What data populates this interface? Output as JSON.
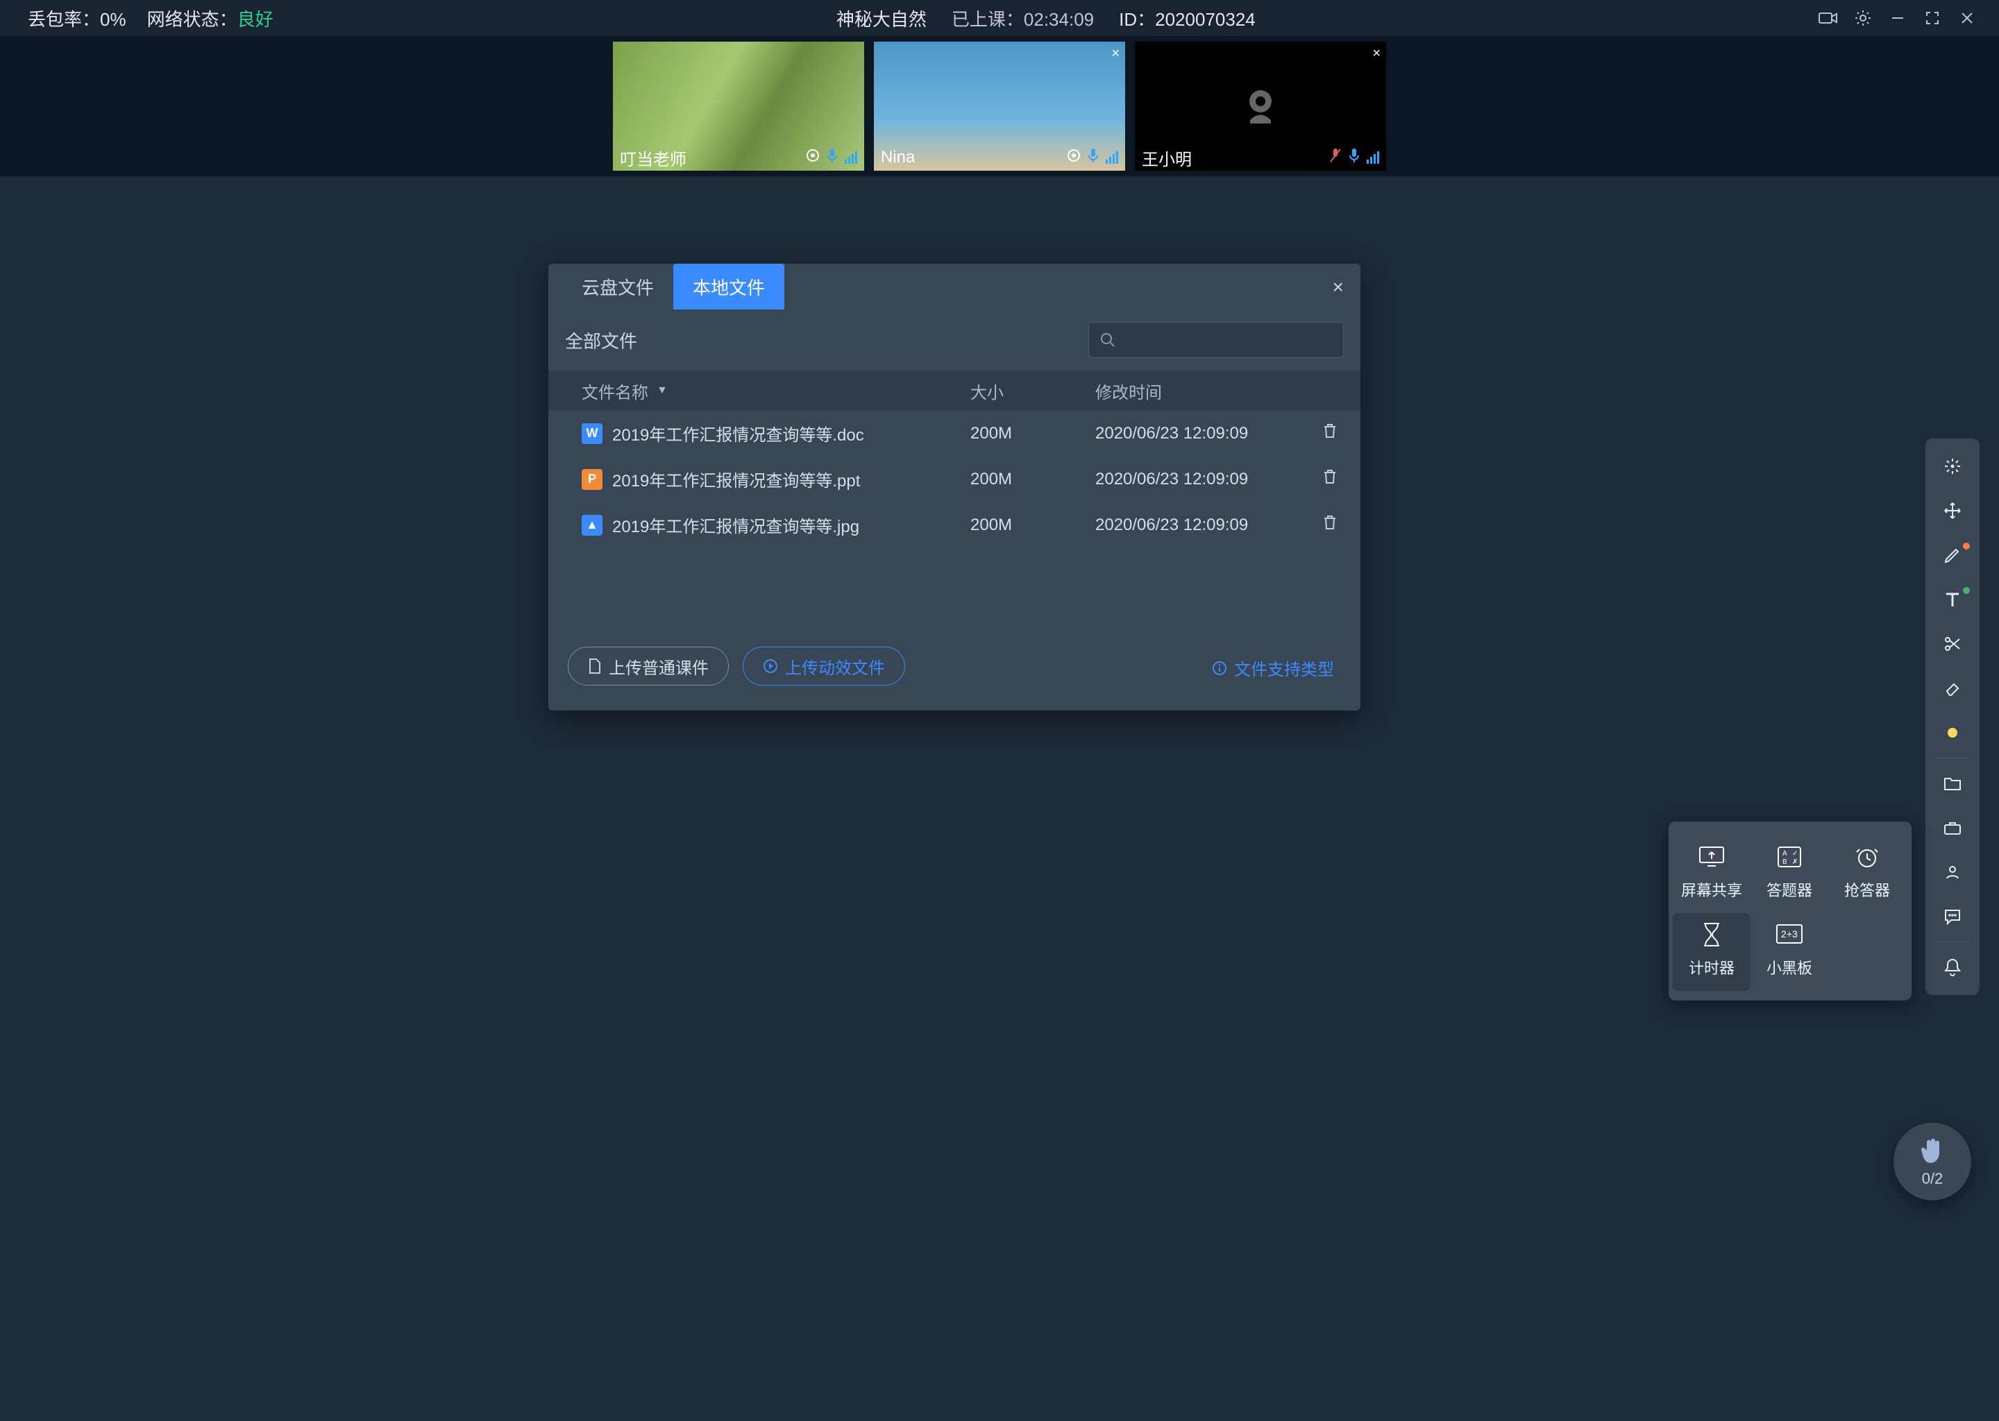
{
  "topbar": {
    "packet_loss_label": "丢包率：",
    "packet_loss_value": "0%",
    "network_label": "网络状态：",
    "network_value": "良好",
    "room_title": "神秘大自然",
    "elapsed_label": "已上课：",
    "elapsed_value": "02:34:09",
    "id_label": "ID：",
    "id_value": "2020070324"
  },
  "participants": [
    {
      "name": "叮当老师",
      "camera_off": false,
      "muted": false,
      "closable": false
    },
    {
      "name": "Nina",
      "camera_off": false,
      "muted": false,
      "closable": true
    },
    {
      "name": "王小明",
      "camera_off": true,
      "muted": true,
      "closable": true
    }
  ],
  "file_dialog": {
    "tabs": {
      "cloud": "云盘文件",
      "local": "本地文件"
    },
    "active_tab": "local",
    "filter_label": "全部文件",
    "search_placeholder": "",
    "columns": {
      "name": "文件名称",
      "size": "大小",
      "mtime": "修改时间"
    },
    "rows": [
      {
        "icon": "W",
        "icon_kind": "doc",
        "name": "2019年工作汇报情况查询等等.doc",
        "size": "200M",
        "mtime": "2020/06/23 12:09:09"
      },
      {
        "icon": "P",
        "icon_kind": "ppt",
        "name": "2019年工作汇报情况查询等等.ppt",
        "size": "200M",
        "mtime": "2020/06/23 12:09:09"
      },
      {
        "icon": "▲",
        "icon_kind": "jpg",
        "name": "2019年工作汇报情况查询等等.jpg",
        "size": "200M",
        "mtime": "2020/06/23 12:09:09"
      }
    ],
    "upload_normal": "上传普通课件",
    "upload_dynamic": "上传动效文件",
    "supported_types": "文件支持类型"
  },
  "tools_popover": {
    "screen_share": "屏幕共享",
    "quiz": "答题器",
    "buzzer": "抢答器",
    "timer": "计时器",
    "blackboard": "小黑板"
  },
  "hand_raise": {
    "count": "0/2"
  },
  "toolbar_names": {
    "laser": "laser-pointer-icon",
    "move": "move-icon",
    "pen": "pen-icon",
    "text": "text-icon",
    "scissors": "scissors-icon",
    "eraser": "eraser-icon",
    "color": "color-picker-icon",
    "folder": "folder-icon",
    "toolbox": "toolbox-icon",
    "users": "users-icon",
    "chat": "chat-icon",
    "bell": "bell-icon"
  }
}
